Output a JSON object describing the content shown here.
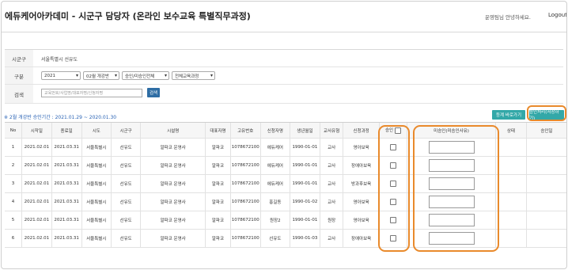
{
  "header": {
    "title": "에듀케어아카데미 - 시군구 담당자 (온라인 보수교육 특별직무과정)",
    "greeting": "운영팀님 안녕하세요.",
    "logout": "Logout"
  },
  "filters": {
    "region_label": "시군구",
    "region_value": "서울특별시 선유도",
    "category_label": "구분",
    "selects": [
      "2021",
      "02월 개강반",
      "승인/미승인전체",
      "전체교육과정"
    ],
    "search_label": "검색",
    "search_placeholder": "교육번호/사업명/대표자명/신청자명",
    "search_button": "검색"
  },
  "period": "※ 2월 개강반 승인기간 : 2021.01.29 ~ 2020.01.30",
  "buttons": {
    "list": "등계 바로가기",
    "approve": "승인처리(저장하기)"
  },
  "table": {
    "headers": [
      "No",
      "시작일",
      "종료일",
      "시도",
      "시군구",
      "시설명",
      "대표자명",
      "고유번호",
      "신청자명",
      "생년월일",
      "교사유형",
      "신청과정",
      "승인",
      "미승인(미승인사유)",
      "상태",
      "승인일"
    ],
    "rows": [
      [
        "1",
        "2021.02.01",
        "2021.03.31",
        "서울특별시",
        "선유도",
        "알파코 운영사",
        "알파코",
        "1078672100",
        "에듀케어",
        "1990-01-01",
        "교사",
        "영아보육"
      ],
      [
        "2",
        "2021.02.01",
        "2021.03.31",
        "서울특별시",
        "선유도",
        "알파코 운영사",
        "알파코",
        "1078672100",
        "에듀케어",
        "1990-01-01",
        "교사",
        "장애아보육"
      ],
      [
        "3",
        "2021.02.01",
        "2021.03.31",
        "서울특별시",
        "선유도",
        "알파코 운영사",
        "알파코",
        "1078672100",
        "에듀케어",
        "1990-01-01",
        "교사",
        "방과후보육"
      ],
      [
        "4",
        "2021.02.01",
        "2021.03.31",
        "서울특별시",
        "선유도",
        "알파코 운영사",
        "알파코",
        "1078672100",
        "홍길동",
        "1990-01-02",
        "교사",
        "영아보육"
      ],
      [
        "5",
        "2021.02.01",
        "2021.03.31",
        "서울특별시",
        "선유도",
        "알파코 운영사",
        "알파코",
        "1078672100",
        "원장2",
        "1990-01-01",
        "원장",
        "영아보육"
      ],
      [
        "6",
        "2021.02.01",
        "2021.03.31",
        "서울특별시",
        "선유도",
        "알파코 운영사",
        "알파코",
        "1078672100",
        "선유도",
        "1990-01-03",
        "교사",
        "장애아보육"
      ]
    ]
  }
}
